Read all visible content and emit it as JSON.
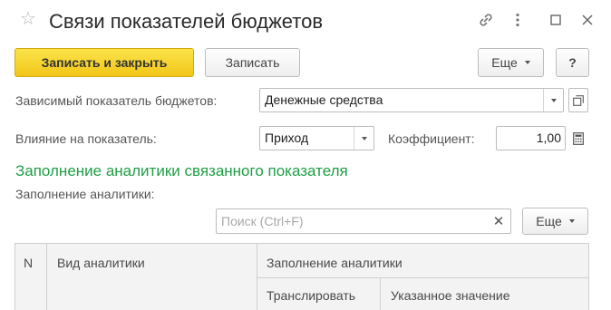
{
  "window": {
    "title": "Связи показателей бюджетов",
    "icons": [
      "star-icon",
      "link-icon",
      "more-vertical-icon",
      "maximize-icon",
      "close-icon"
    ]
  },
  "toolbar": {
    "save_close_label": "Записать и закрыть",
    "save_label": "Записать",
    "more_label": "Еще",
    "help_label": "?"
  },
  "form": {
    "dependent_label": "Зависимый показатель бюджетов:",
    "dependent_value": "Денежные средства",
    "influence_label": "Влияние на показатель:",
    "influence_value": "Приход",
    "coefficient_label": "Коэффициент:",
    "coefficient_value": "1,00"
  },
  "analytics": {
    "section_title": "Заполнение аналитики связанного показателя",
    "fill_label": "Заполнение аналитики:",
    "search_placeholder": "Поиск (Ctrl+F)",
    "more_label": "Еще"
  },
  "table": {
    "columns": {
      "n": "N",
      "kind": "Вид аналитики",
      "fill": "Заполнение аналитики",
      "translate": "Транслировать",
      "specified": "Указанное значение"
    }
  },
  "colors": {
    "accent_green": "#1f9e45",
    "primary_button": "#f5d430"
  }
}
